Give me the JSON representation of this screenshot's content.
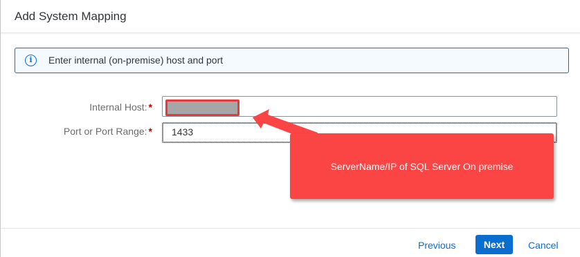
{
  "dialog": {
    "title": "Add System Mapping"
  },
  "info": {
    "icon": "info-icon",
    "glyph": "i",
    "text": "Enter internal (on-premise) host and port"
  },
  "form": {
    "internal_host": {
      "label": "Internal Host:",
      "required_marker": "*",
      "value": ""
    },
    "port": {
      "label": "Port or Port Range:",
      "required_marker": "*",
      "value": "1433"
    }
  },
  "annotation": {
    "text": "ServerName/IP of SQL Server On premise",
    "color": "#fb4444"
  },
  "footer": {
    "previous_label": "Previous",
    "next_label": "Next",
    "cancel_label": "Cancel"
  },
  "colors": {
    "accent": "#0a6ed1",
    "required": "#bb0000",
    "highlight_border": "#e63b3b"
  }
}
